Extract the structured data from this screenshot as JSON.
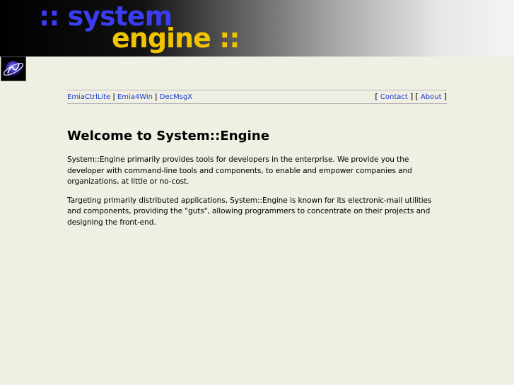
{
  "banner": {
    "line1": ":: system",
    "line2": "engine ::"
  },
  "nav": {
    "left": [
      {
        "label": "EmiaCtrlLite"
      },
      {
        "label": "Emia4Win"
      },
      {
        "label": "DecMsgX"
      }
    ],
    "separator": "|",
    "right": [
      {
        "label": "Contact"
      },
      {
        "label": "About"
      }
    ],
    "bracket_open": "[",
    "bracket_close": "]"
  },
  "main": {
    "heading": "Welcome to System::Engine",
    "paragraphs": [
      "System::Engine primarily provides tools for developers in the enterprise. We provide you the developer with command-line tools and components, to enable and empower companies and organizations, at little or no-cost.",
      "Targeting primarily distributed applications, System::Engine is known for its electronic-mail utilities and components, providing the \"guts\", allowing programmers to concentrate on their projects and designing the front-end."
    ]
  }
}
